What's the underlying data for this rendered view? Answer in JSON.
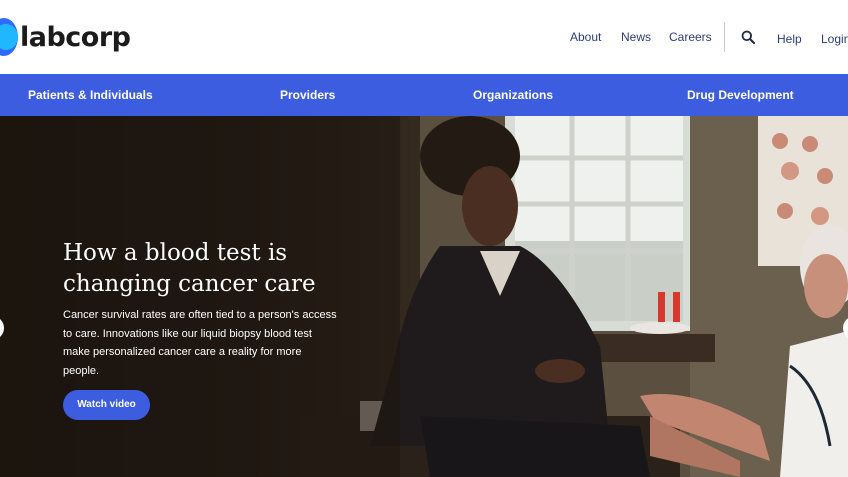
{
  "header": {
    "brand": "labcorp",
    "nav": {
      "about": "About",
      "news": "News",
      "careers": "Careers",
      "help": "Help",
      "login": "Login"
    },
    "icons": {
      "search": "search-icon"
    }
  },
  "mainnav": {
    "items": [
      "Patients & Individuals",
      "Providers",
      "Organizations",
      "Drug Development"
    ]
  },
  "hero": {
    "title": "How a blood test is changing cancer care",
    "body": "Cancer survival rates are often tied to a person's access to care. Innovations like our liquid biopsy blood test make personalized cancer care a reality for more people.",
    "cta": "Watch video"
  },
  "colors": {
    "brand_blue": "#3c5de0",
    "nav_text": "#2b3d7a",
    "logo_blue": "#2f6bff",
    "logo_cyan": "#1fb8ff"
  }
}
